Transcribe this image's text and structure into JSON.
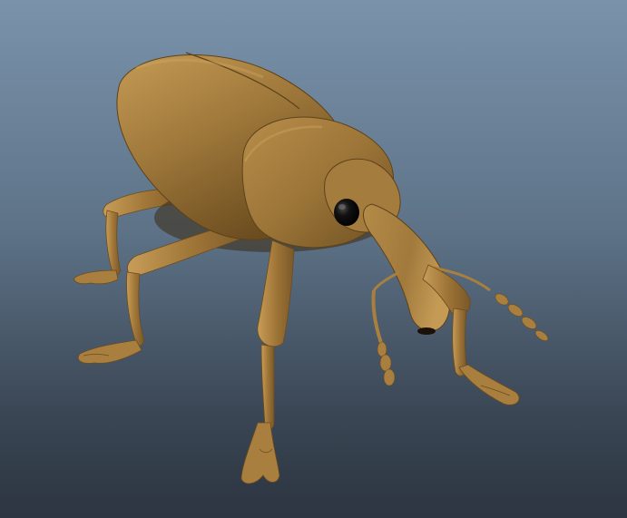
{
  "scene": {
    "subject_icon": "weevil-icon",
    "colors": {
      "body": "#a17a3c",
      "body_light": "#c59a55",
      "body_dark": "#6b4c1f",
      "eye": "#0a0a0a",
      "background_top": "#7a93ab",
      "background_bottom": "#2c3540"
    }
  }
}
